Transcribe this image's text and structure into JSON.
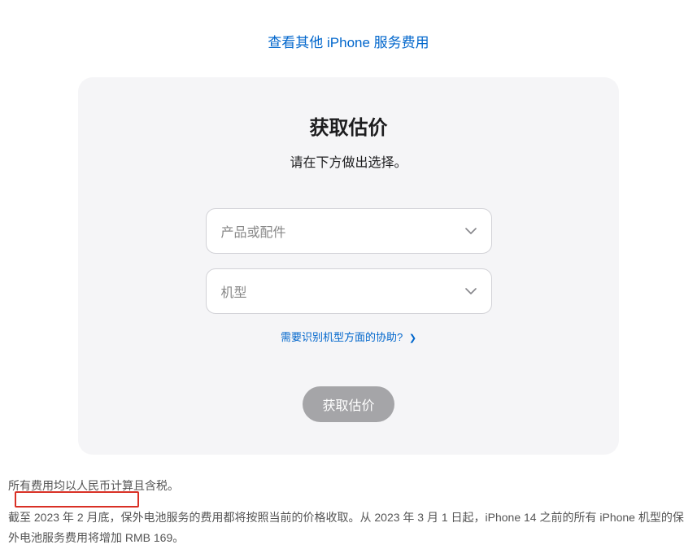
{
  "topLink": {
    "label": "查看其他 iPhone 服务费用"
  },
  "card": {
    "title": "获取估价",
    "subtitle": "请在下方做出选择。",
    "selects": {
      "product": {
        "placeholder": "产品或配件"
      },
      "model": {
        "placeholder": "机型"
      }
    },
    "helpLink": {
      "label": "需要识别机型方面的协助?"
    },
    "submitLabel": "获取估价"
  },
  "footer": {
    "line1": "所有费用均以人民币计算且含税。",
    "line2": "截至 2023 年 2 月底，保外电池服务的费用都将按照当前的价格收取。从 2023 年 3 月 1 日起，iPhone 14 之前的所有 iPhone 机型的保外电池服务费用将增加 RMB 169。"
  }
}
